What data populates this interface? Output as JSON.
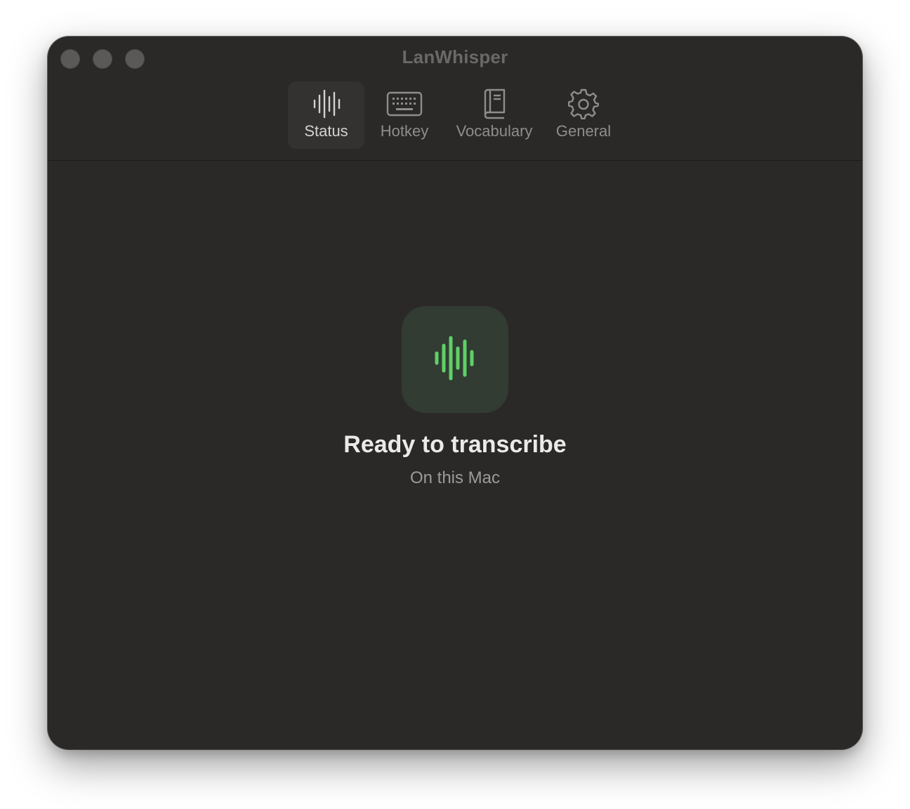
{
  "window": {
    "title": "LanWhisper"
  },
  "toolbar": {
    "tabs": [
      {
        "label": "Status",
        "icon": "waveform-icon",
        "selected": true
      },
      {
        "label": "Hotkey",
        "icon": "keyboard-icon",
        "selected": false
      },
      {
        "label": "Vocabulary",
        "icon": "book-icon",
        "selected": false
      },
      {
        "label": "General",
        "icon": "gear-icon",
        "selected": false
      }
    ]
  },
  "status": {
    "icon": "waveform-icon",
    "accent_color": "#5fd068",
    "headline": "Ready to transcribe",
    "detail": "On this Mac"
  }
}
